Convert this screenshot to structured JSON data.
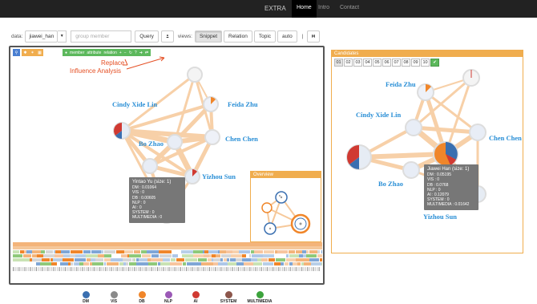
{
  "nav": {
    "brand": "EXTRA",
    "items": [
      {
        "label": "Home"
      },
      {
        "label": "Intro"
      },
      {
        "label": "Contact"
      }
    ]
  },
  "toolbar": {
    "data_label": "data:",
    "data_value": "jiawei_han",
    "group_placeholder": "group member",
    "query_label": "Query",
    "views_label": "views:",
    "views": [
      {
        "label": "Snippet"
      },
      {
        "label": "Relation"
      },
      {
        "label": "Topic"
      },
      {
        "label": "auto"
      }
    ],
    "separator": "|"
  },
  "graph_toolbar": {
    "items": [
      "member",
      "attribute",
      "relation"
    ]
  },
  "annotations": {
    "replace": "Replace",
    "influence": "Influence Analysis"
  },
  "nodes": {
    "cindy": "Cindy Xide Lin",
    "feida": "Feida Zhu",
    "chen": "Chen Chen",
    "bo": "Bo Zhao",
    "yizhou": "Yizhou Sun"
  },
  "tooltip_left": {
    "title": "Yintao Yu (size: 1)",
    "lines": [
      "DM : 0.01064",
      "VIS : 0",
      "DB : 0.00605",
      "NLP : 0",
      "AI : 0",
      "SYSTEM : 0",
      "MULTIMEDIA : 0"
    ]
  },
  "overview_title": "Overview",
  "candidates": {
    "title": "Candidates",
    "numbers": [
      "01",
      "02",
      "03",
      "04",
      "05",
      "06",
      "07",
      "08",
      "09",
      "10"
    ]
  },
  "tooltip_right": {
    "title": "Jiawei Han (size: 1)",
    "lines": [
      "DM : 0.05195",
      "VIS : 0",
      "DB : 0.0768",
      "NLP : 0",
      "AI : 0.12079",
      "SYSTEM : 0",
      "MULTIMEDIA : 0.01642"
    ]
  },
  "legend": [
    {
      "label": "DM",
      "color": "#3a6fb0"
    },
    {
      "label": "VIS",
      "color": "#8a8a8a"
    },
    {
      "label": "DB",
      "color": "#f0862a"
    },
    {
      "label": "NLP",
      "color": "#9b59b6"
    },
    {
      "label": "AI",
      "color": "#d03a32"
    },
    {
      "label": "SYSTEM",
      "color": "#8c564b"
    },
    {
      "label": "MULTIMEDIA",
      "color": "#3ca33c"
    }
  ],
  "colors": {
    "accent": "#f0ad4e",
    "link": "#2a8fd6",
    "annotation": "#e55025",
    "edge": "#f6c89a"
  }
}
